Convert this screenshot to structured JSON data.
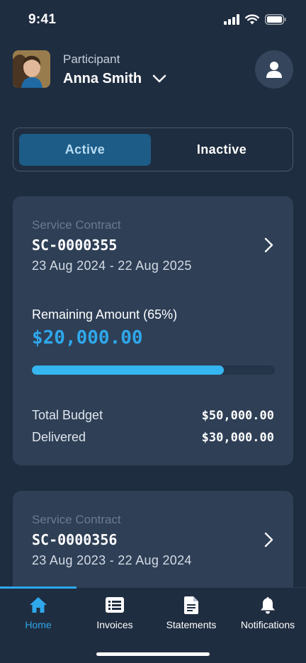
{
  "status_bar": {
    "time": "9:41",
    "icons": [
      "signal-icon",
      "wifi-icon",
      "battery-icon"
    ]
  },
  "header": {
    "participant_label": "Participant",
    "participant_name": "Anna Smith",
    "icons": [
      "chevron-down-icon",
      "user-icon"
    ]
  },
  "filter": {
    "options": [
      "Active",
      "Inactive"
    ],
    "selected": "Active"
  },
  "contracts": [
    {
      "label": "Service Contract",
      "id": "SC-0000355",
      "dates": "23 Aug 2024 - 22 Aug 2025",
      "remaining_label": "Remaining Amount (65%)",
      "remaining_value": "$20,000.00",
      "progress_fraction": 0.79,
      "total_budget_label": "Total Budget",
      "total_budget_value": "$50,000.00",
      "delivered_label": "Delivered",
      "delivered_value": "$30,000.00"
    },
    {
      "label": "Service Contract",
      "id": "SC-0000356",
      "dates": "23 Aug 2023 - 22 Aug 2024"
    }
  ],
  "tabs": [
    {
      "label": "Home",
      "icon": "home-icon",
      "active": true
    },
    {
      "label": "Invoices",
      "icon": "list-icon",
      "active": false
    },
    {
      "label": "Statements",
      "icon": "document-icon",
      "active": false
    },
    {
      "label": "Notifications",
      "icon": "bell-icon",
      "active": false
    }
  ],
  "colors": {
    "background": "#1f2d40",
    "card": "#2e3f56",
    "accent": "#2fa8ec",
    "segment_active": "#1d5c87"
  }
}
